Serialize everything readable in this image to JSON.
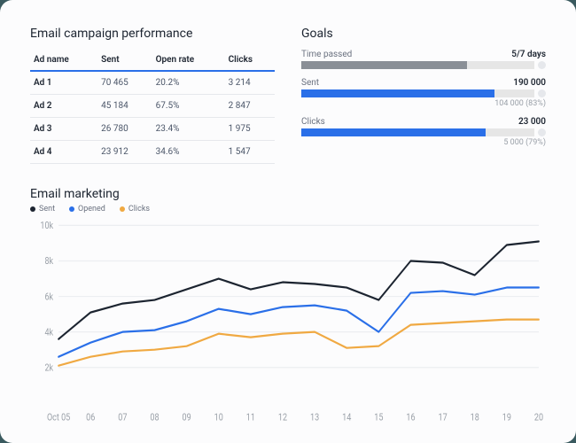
{
  "table": {
    "title": "Email campaign performance",
    "headers": [
      "Ad name",
      "Sent",
      "Open rate",
      "Clicks"
    ],
    "rows": [
      {
        "name": "Ad 1",
        "sent": "70 465",
        "open_rate": "20.2%",
        "clicks": "3 214"
      },
      {
        "name": "Ad 2",
        "sent": "45 184",
        "open_rate": "67.5%",
        "clicks": "2 847"
      },
      {
        "name": "Ad 3",
        "sent": "26 780",
        "open_rate": "23.4%",
        "clicks": "1 975"
      },
      {
        "name": "Ad 4",
        "sent": "23 912",
        "open_rate": "34.6%",
        "clicks": "1 547"
      }
    ]
  },
  "goals": {
    "title": "Goals",
    "items": [
      {
        "label": "Time passed",
        "value": "5/7 days",
        "sub": "",
        "pct": 71,
        "style": "gray"
      },
      {
        "label": "Sent",
        "value": "190 000",
        "sub": "104 000 (83%)",
        "pct": 83,
        "style": "blue"
      },
      {
        "label": "Clicks",
        "value": "23 000",
        "sub": "5 000 (79%)",
        "pct": 79,
        "style": "blue"
      }
    ]
  },
  "chart": {
    "title": "Email marketing",
    "legend": [
      {
        "name": "Sent",
        "color": "#1c2430"
      },
      {
        "name": "Opened",
        "color": "#2a6fe8"
      },
      {
        "name": "Clicks",
        "color": "#f0a942"
      }
    ]
  },
  "chart_data": {
    "type": "line",
    "title": "Email marketing",
    "xlabel": "",
    "ylabel": "",
    "ylim": [
      0,
      10000
    ],
    "yticks": [
      "2k",
      "4k",
      "6k",
      "8k",
      "10k"
    ],
    "categories": [
      "Oct 05",
      "06",
      "07",
      "08",
      "09",
      "10",
      "11",
      "12",
      "13",
      "14",
      "15",
      "16",
      "17",
      "18",
      "19",
      "20"
    ],
    "series": [
      {
        "name": "Sent",
        "color": "#1c2430",
        "values": [
          3600,
          5100,
          5600,
          5800,
          6400,
          7000,
          6400,
          6800,
          6700,
          6500,
          5800,
          8000,
          7900,
          7200,
          8900,
          9100
        ]
      },
      {
        "name": "Opened",
        "color": "#2a6fe8",
        "values": [
          2600,
          3400,
          4000,
          4100,
          4600,
          5300,
          5000,
          5400,
          5500,
          5200,
          4000,
          6200,
          6300,
          6100,
          6500,
          6500
        ]
      },
      {
        "name": "Clicks",
        "color": "#f0a942",
        "values": [
          2100,
          2600,
          2900,
          3000,
          3200,
          3900,
          3700,
          3900,
          4000,
          3100,
          3200,
          4400,
          4500,
          4600,
          4700,
          4700
        ]
      }
    ]
  }
}
